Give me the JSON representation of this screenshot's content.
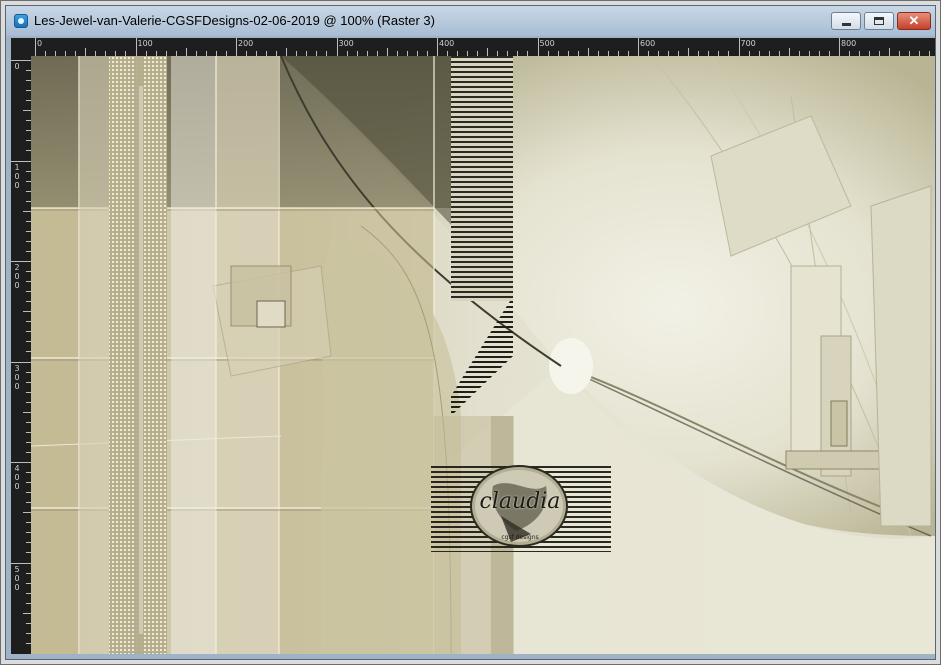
{
  "window": {
    "title": "Les-Jewel-van-Valerie-CGSFDesigns-02-06-2019 @ 100% (Raster 3)",
    "buttons": {
      "minimize": "minimize",
      "maximize": "maximize",
      "close": "✕"
    }
  },
  "rulers": {
    "top_labels": [
      "0",
      "100",
      "200",
      "300",
      "400",
      "500",
      "600",
      "700",
      "800"
    ],
    "left_labels": [
      "0",
      "100",
      "200",
      "300",
      "400",
      "500"
    ]
  },
  "watermark": {
    "text": "claudia",
    "subtext": "cgsf designs"
  },
  "colors": {
    "titlebar": "#b7c9dc",
    "ruler": "#1e1e1e",
    "canvas_dark": "#6b6750",
    "canvas_mid": "#b7ae8a",
    "canvas_light": "#ecebdf"
  }
}
